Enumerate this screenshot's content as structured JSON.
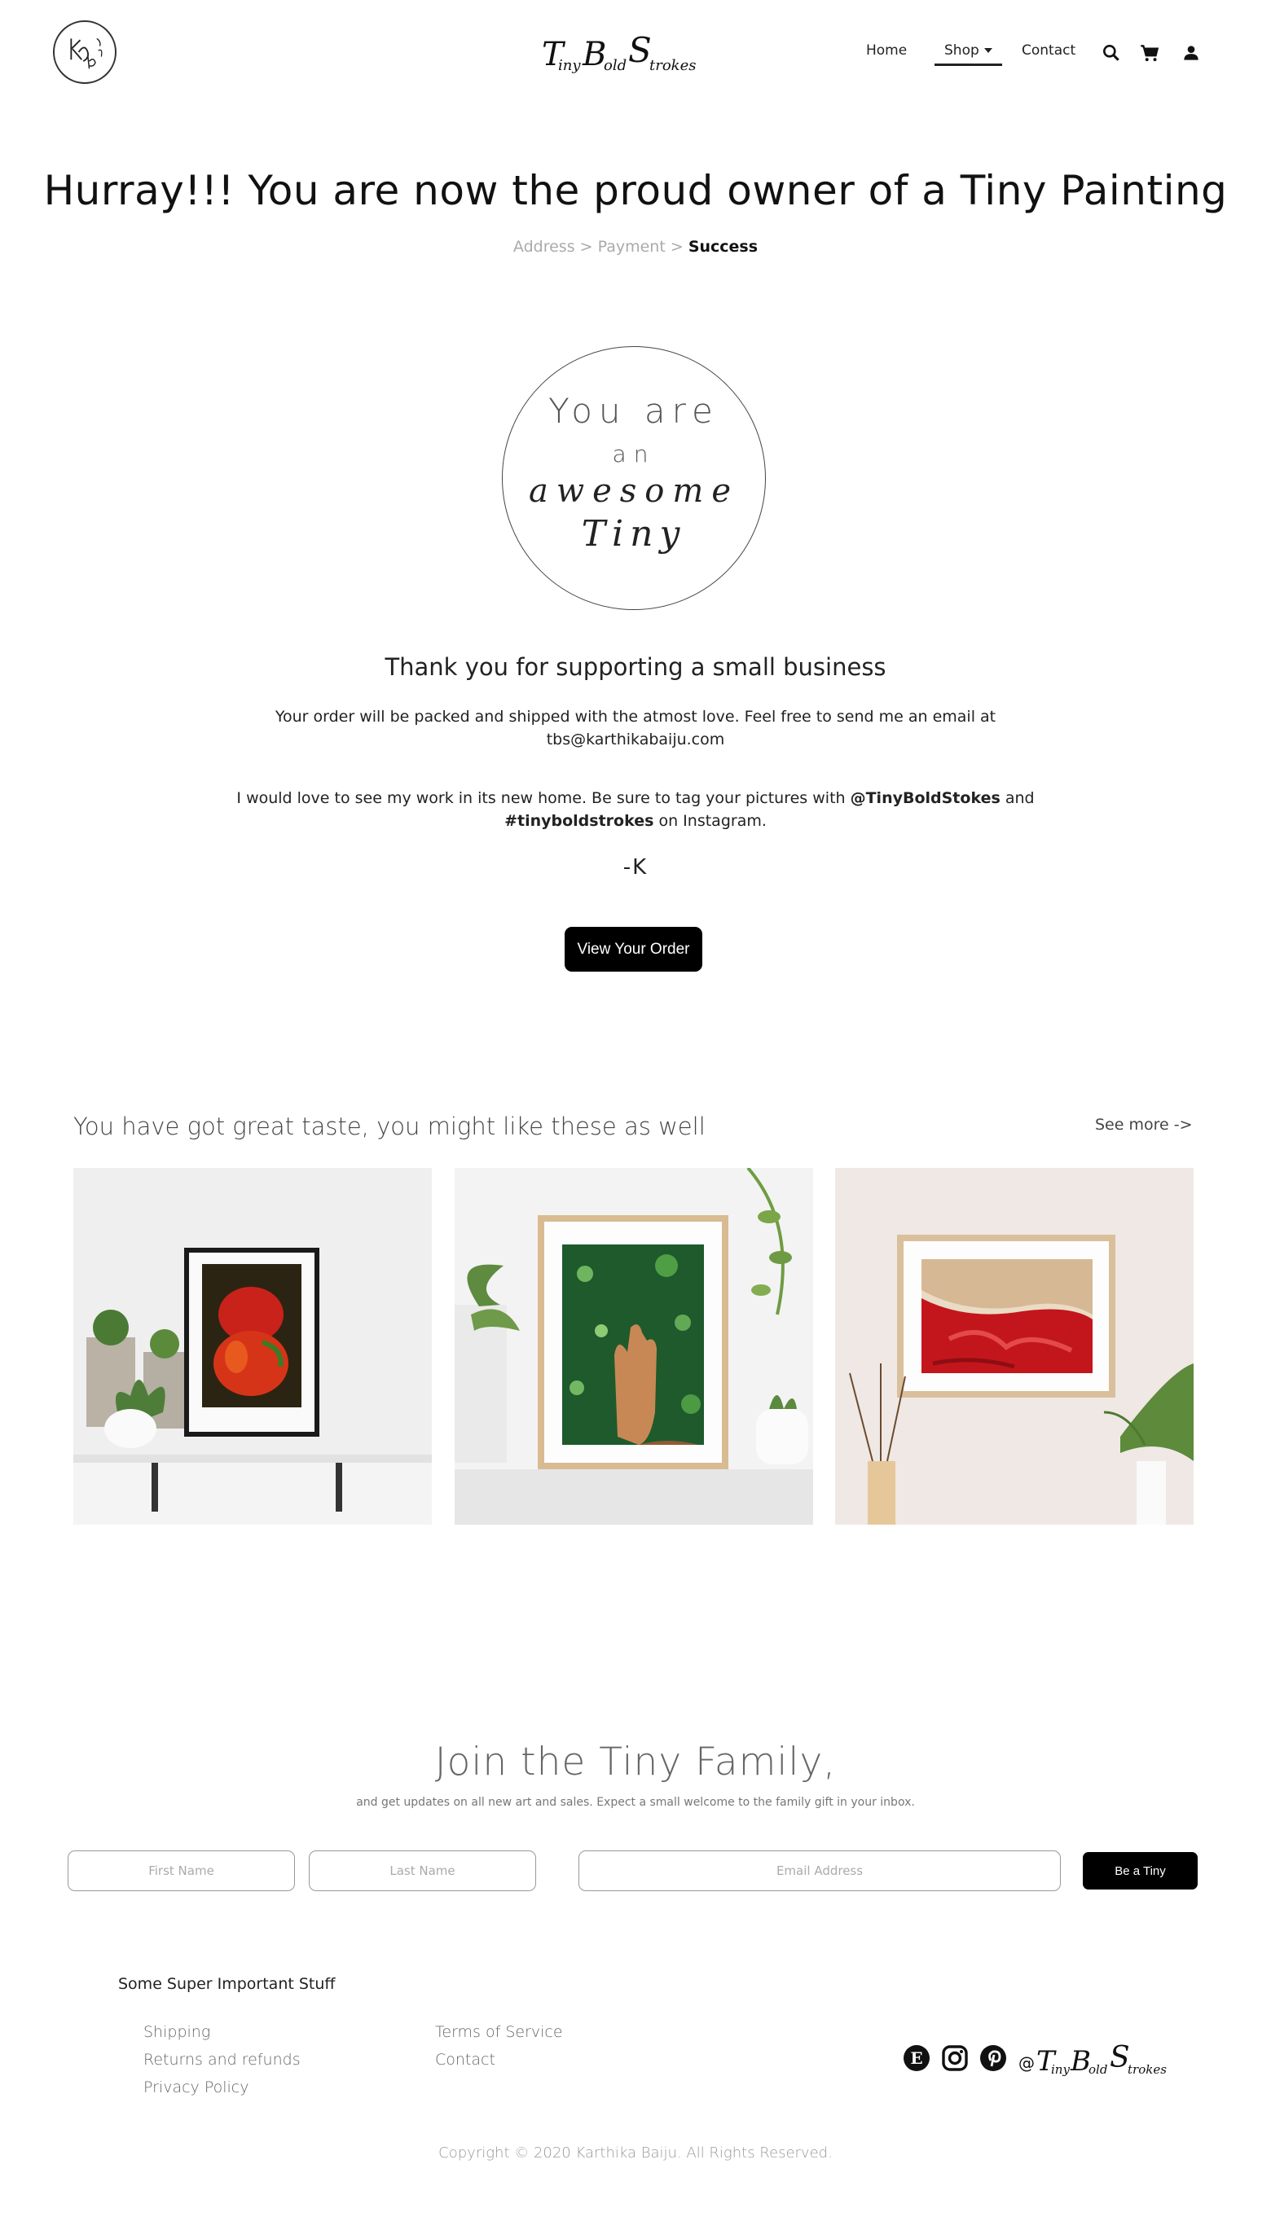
{
  "header": {
    "logo_monogram": "KB TinyBoldStrokes",
    "brand": "TinyBoldStrokes",
    "nav": [
      {
        "label": "Home"
      },
      {
        "label": "Shop"
      },
      {
        "label": "Contact"
      }
    ],
    "icons": [
      "search-icon",
      "cart-icon",
      "user-icon"
    ]
  },
  "hero": {
    "title": "Hurray!!! You are now the proud owner of a Tiny Painting",
    "breadcrumb": {
      "step1": "Address",
      "sep": ">",
      "step2": "Payment",
      "current": "Success"
    },
    "badge": {
      "line1": "You are",
      "line2": "an",
      "line3": "awesome",
      "line4": "Tiny"
    },
    "thanks": "Thank you for supporting a small business",
    "para1": "Your order will be packed and shipped with the atmost love. Feel free to send me an email at tbs@karthikabaiju.com",
    "para2_a": "I would love to see my work in its new home. Be sure to tag your pictures with ",
    "para2_handle": "@TinyBoldStokes",
    "para2_b": " and ",
    "para2_tag": "#tinyboldstrokes",
    "para2_c": " on Instagram.",
    "sign": "-K",
    "cta": "View Your Order"
  },
  "recommendations": {
    "title": "You have got great taste, you might like these as well",
    "see_more": "See more ->",
    "cards": [
      {
        "name": "Red bell peppers painting"
      },
      {
        "name": "Hand in rain painting"
      },
      {
        "name": "Red dress painting"
      }
    ]
  },
  "join": {
    "title": "Join the Tiny Family,",
    "subtitle": "and get updates on all new art and sales. Expect a small welcome to the family gift in your inbox.",
    "first_placeholder": "First Name",
    "last_placeholder": "Last Name",
    "email_placeholder": "Email Address",
    "button": "Be a Tiny"
  },
  "footer": {
    "heading": "Some Super Important Stuff",
    "col1": [
      "Shipping",
      "Returns and refunds",
      "Privacy Policy"
    ],
    "col2": [
      "Terms of Service",
      "Contact"
    ],
    "social": [
      "etsy-icon",
      "instagram-icon",
      "pinterest-icon"
    ],
    "handle_prefix": "@",
    "handle_brand": "TinyBoldStrokes",
    "copyright": "Copyright © 2020 Karthika Baiju. All Rights Reserved."
  }
}
